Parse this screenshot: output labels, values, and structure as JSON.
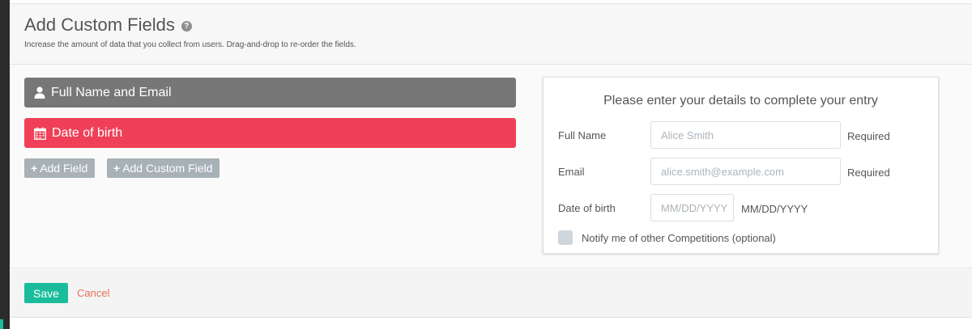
{
  "header": {
    "title": "Add Custom Fields",
    "help_icon": "?",
    "subtitle": "Increase the amount of data that you collect from users. Drag-and-drop to re-order the fields."
  },
  "fields": [
    {
      "label": "Full Name and Email",
      "icon": "user-icon",
      "color": "#777777"
    },
    {
      "label": "Date of birth",
      "icon": "calendar-icon",
      "color": "#ef4058"
    }
  ],
  "buttons": {
    "add_field": "Add Field",
    "add_custom_field": "Add Custom Field"
  },
  "preview": {
    "title": "Please enter your details to complete your entry",
    "full_name": {
      "label": "Full Name",
      "placeholder": "Alice Smith",
      "note": "Required"
    },
    "email": {
      "label": "Email",
      "placeholder": "alice.smith@example.com",
      "note": "Required"
    },
    "dob": {
      "label": "Date of birth",
      "placeholder": "MM/DD/YYYY",
      "format": "MM/DD/YYYY"
    },
    "notify": {
      "label": "Notify me of other Competitions (optional)",
      "checked": false
    }
  },
  "footer": {
    "save": "Save",
    "cancel": "Cancel"
  },
  "colors": {
    "accent": "#1abc9c",
    "danger": "#ef4058",
    "cancel": "#e57055"
  }
}
